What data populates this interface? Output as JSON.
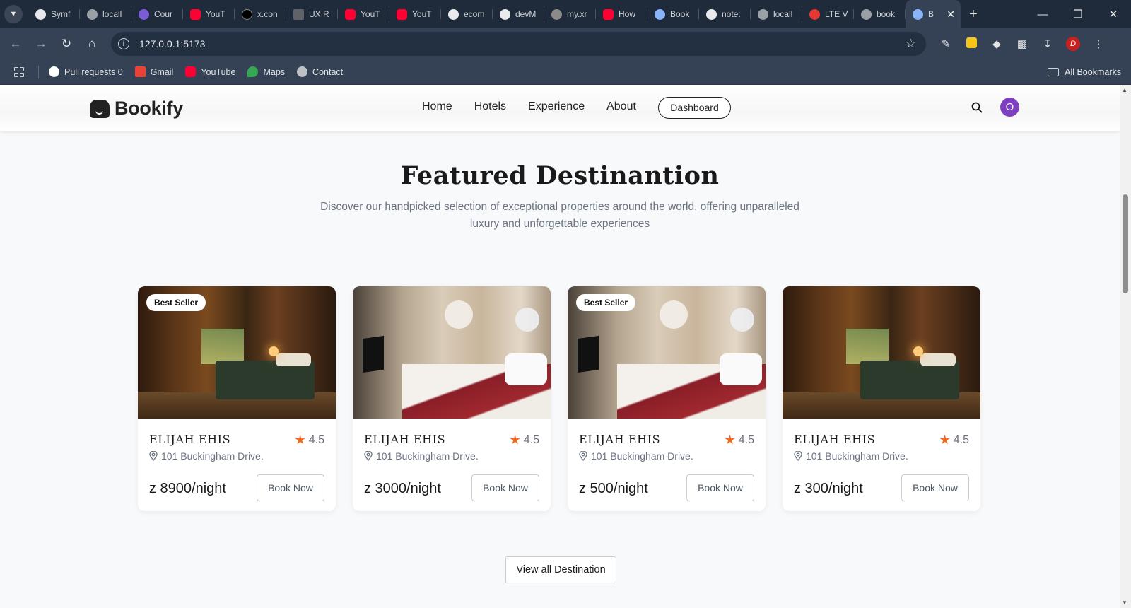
{
  "browser": {
    "tabs": [
      {
        "label": "Symf",
        "color": "#e8eaed"
      },
      {
        "label": "locall",
        "color": "#9aa0a6"
      },
      {
        "label": "Cour",
        "color": "#7b5cd6"
      },
      {
        "label": "YouT",
        "color": "#ff0033"
      },
      {
        "label": "x.con",
        "color": "#000000"
      },
      {
        "label": "UX R",
        "color": "#5f6368"
      },
      {
        "label": "YouT",
        "color": "#ff0033"
      },
      {
        "label": "YouT",
        "color": "#ff0033"
      },
      {
        "label": "ecom",
        "color": "#e8eaed"
      },
      {
        "label": "devM",
        "color": "#e8eaed"
      },
      {
        "label": "my.xr",
        "color": "#8a8a8a"
      },
      {
        "label": "How",
        "color": "#ff0033"
      },
      {
        "label": "Book",
        "color": "#8ab4f8"
      },
      {
        "label": "note:",
        "color": "#e8eaed"
      },
      {
        "label": "locall",
        "color": "#9aa0a6"
      },
      {
        "label": "LTE V",
        "color": "#e53935"
      },
      {
        "label": "book",
        "color": "#9aa0a6"
      },
      {
        "label": "B",
        "color": "#8ab4f8"
      }
    ],
    "url": "127.0.0.1:5173",
    "bookmarks": [
      {
        "label": "Pull requests 0",
        "color": "#ffffff"
      },
      {
        "label": "Gmail",
        "color": "#ea4335"
      },
      {
        "label": "YouTube",
        "color": "#ff0033"
      },
      {
        "label": "Maps",
        "color": "#34a853"
      },
      {
        "label": "Contact",
        "color": "#bdc1c6"
      }
    ],
    "all_bookmarks": "All Bookmarks",
    "profile_initial": "D"
  },
  "site": {
    "brand": "Bookify",
    "nav": [
      "Home",
      "Hotels",
      "Experience",
      "About"
    ],
    "dashboard_label": "Dashboard",
    "user_initial": "O"
  },
  "section": {
    "title": "Featured Destinantion",
    "subtitle": "Discover our handpicked selection of exceptional properties around the world, offering unparalleled luxury and unforgettable experiences",
    "view_all": "View all Destination"
  },
  "cards": [
    {
      "name": "ELIJAH EHIS",
      "rating": "4.5",
      "address": "101 Buckingham Drive.",
      "price": "z 8900/night",
      "badge": "Best Seller",
      "book": "Book Now"
    },
    {
      "name": "ELIJAH EHIS",
      "rating": "4.5",
      "address": "101 Buckingham Drive.",
      "price": "z 3000/night",
      "badge": "",
      "book": "Book Now"
    },
    {
      "name": "ELIJAH EHIS",
      "rating": "4.5",
      "address": "101 Buckingham Drive.",
      "price": "z 500/night",
      "badge": "Best Seller",
      "book": "Book Now"
    },
    {
      "name": "ELIJAH EHIS",
      "rating": "4.5",
      "address": "101 Buckingham Drive.",
      "price": "z 300/night",
      "badge": "",
      "book": "Book Now"
    }
  ],
  "colors": {
    "accent_star": "#f26b1d",
    "avatar": "#7e3fc0",
    "chrome_dark": "#1f2a3a"
  }
}
